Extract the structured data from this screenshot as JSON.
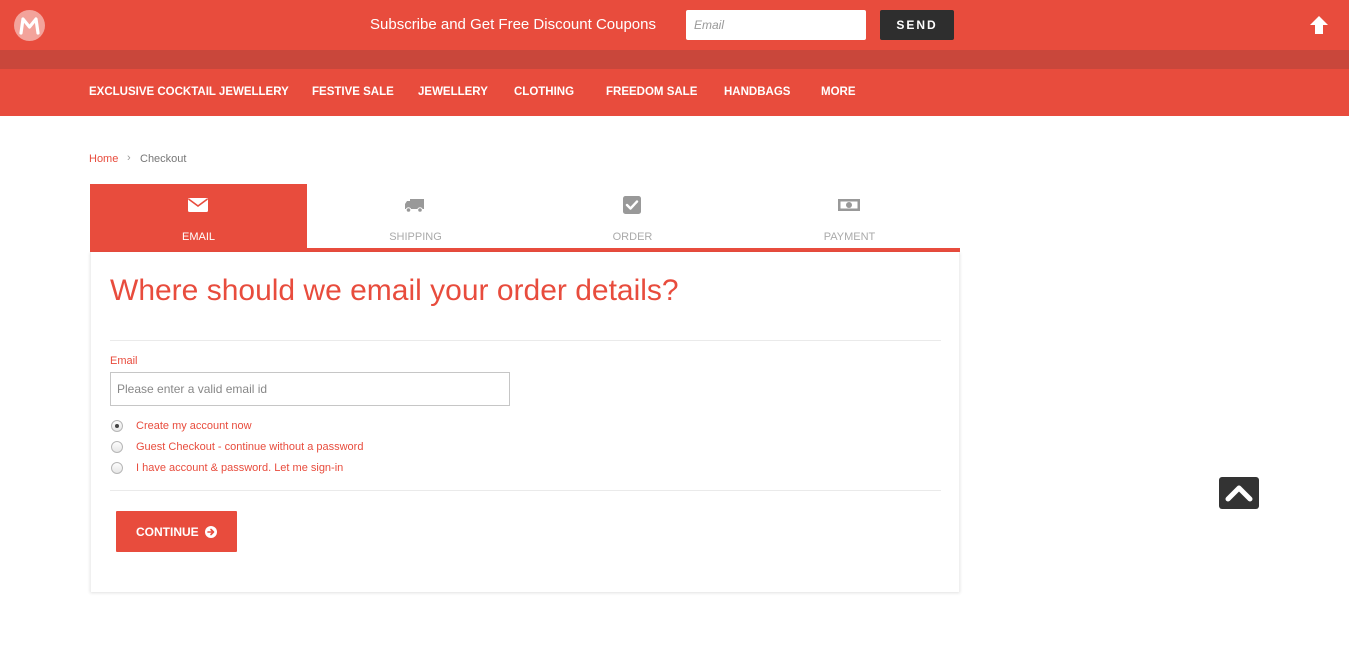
{
  "topbar": {
    "logo_icon": "m-logo-icon",
    "subscribe_text": "Subscribe and Get Free Discount Coupons",
    "email_placeholder": "Email",
    "send_label": "SEND",
    "up_icon": "arrow-up-icon"
  },
  "nav": {
    "items": [
      {
        "label": "EXCLUSIVE COCKTAIL JEWELLERY"
      },
      {
        "label": "FESTIVE SALE"
      },
      {
        "label": "JEWELLERY"
      },
      {
        "label": "CLOTHING"
      },
      {
        "label": "FREEDOM SALE"
      },
      {
        "label": "HANDBAGS"
      },
      {
        "label": "MORE"
      }
    ]
  },
  "breadcrumb": {
    "home": "Home",
    "separator": "›",
    "current": "Checkout"
  },
  "steps": [
    {
      "label": "EMAIL",
      "icon": "envelope-icon",
      "active": true
    },
    {
      "label": "SHIPPING",
      "icon": "truck-icon",
      "active": false
    },
    {
      "label": "ORDER",
      "icon": "checkbox-icon",
      "active": false
    },
    {
      "label": "PAYMENT",
      "icon": "money-icon",
      "active": false
    }
  ],
  "form": {
    "heading": "Where should we email your order details?",
    "email_label": "Email",
    "email_placeholder": "Please enter a valid email id",
    "email_value": "",
    "options": [
      {
        "label": "Create my account now",
        "checked": true
      },
      {
        "label": "Guest Checkout - continue without a password",
        "checked": false
      },
      {
        "label": "I have account & password. Let me sign-in",
        "checked": false
      }
    ],
    "continue_label": "CONTINUE"
  },
  "colors": {
    "brand": "#e84c3d",
    "brand_dark": "#c9473b",
    "dark_button": "#2e2e2e"
  }
}
